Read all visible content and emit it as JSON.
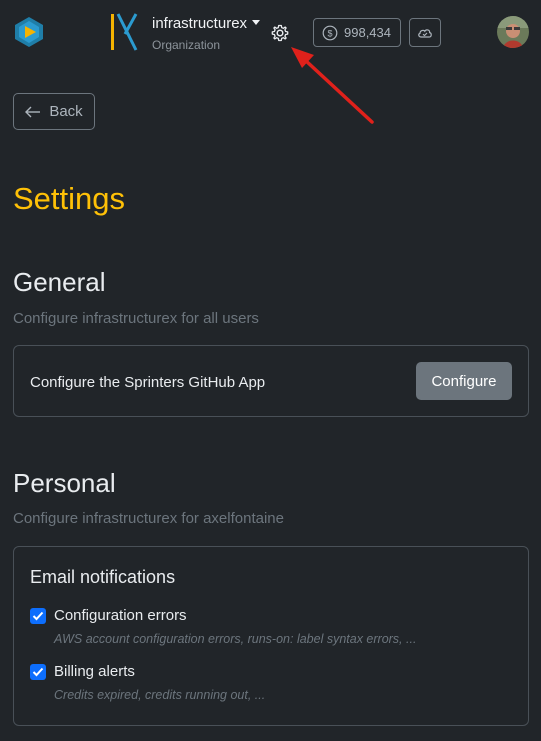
{
  "header": {
    "org_name": "infrastructurex",
    "org_type": "Organization",
    "credits": "998,434"
  },
  "nav": {
    "back_label": "Back"
  },
  "page": {
    "title": "Settings"
  },
  "general": {
    "title": "General",
    "subtitle": "Configure infrastructurex for all users",
    "github_app_label": "Configure the Sprinters GitHub App",
    "configure_label": "Configure"
  },
  "personal": {
    "title": "Personal",
    "subtitle": "Configure infrastructurex for axelfontaine",
    "email_title": "Email notifications",
    "options": [
      {
        "label": "Configuration errors",
        "description": "AWS account configuration errors, runs-on: label syntax errors, ...",
        "checked": true
      },
      {
        "label": "Billing alerts",
        "description": "Credits expired, credits running out, ...",
        "checked": true
      }
    ]
  },
  "colors": {
    "accent": "#ffc107",
    "checkbox": "#0d6efd",
    "arrow": "#e0211b",
    "background": "#212529"
  }
}
